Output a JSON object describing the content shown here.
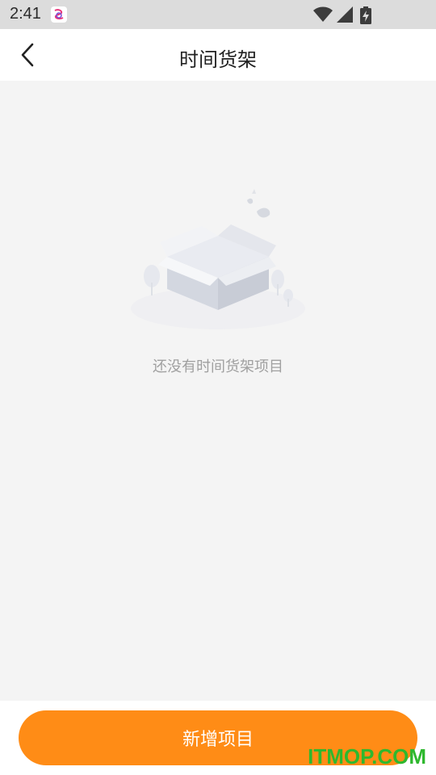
{
  "status_bar": {
    "time": "2:41",
    "icons": [
      "app-notification-icon",
      "wifi-icon",
      "cell-signal-icon",
      "battery-charging-icon"
    ]
  },
  "header": {
    "title": "时间货架",
    "back_icon": "chevron-left-icon"
  },
  "empty_state": {
    "illustration": "empty-box-icon",
    "message": "还没有时间货架项目"
  },
  "bottom_bar": {
    "add_label": "新增项目"
  },
  "watermark": "ITMOP.COM",
  "colors": {
    "accent": "#ff8c16",
    "background": "#f4f4f4",
    "watermark": "#2eb82e"
  }
}
